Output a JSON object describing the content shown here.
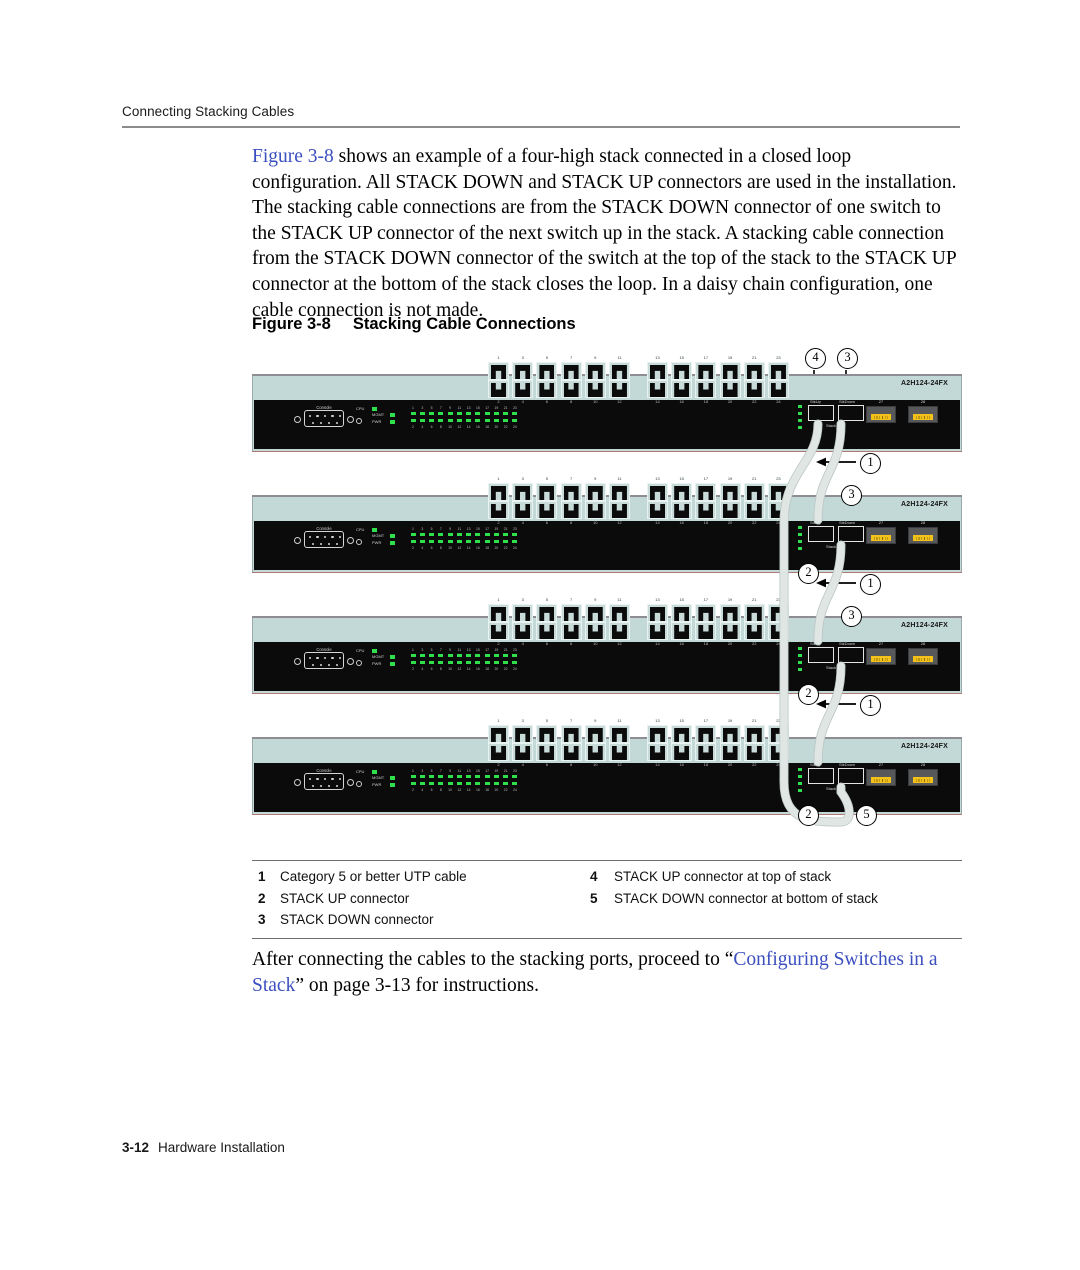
{
  "header": {
    "running_head": "Connecting Stacking Cables"
  },
  "body": {
    "paragraph_lead": "Figure 3-8",
    "paragraph_rest": " shows an example of a four-high stack connected in a closed loop configuration. All STACK DOWN and STACK UP connectors are used in the installation. The stacking cable connections are from the STACK DOWN connector of one switch to the STACK UP connector of the next switch up in the stack. A stacking cable connection from the STACK DOWN connector of the switch at the top of the stack to the STACK UP connector at the bottom of the stack closes the loop. In a daisy chain configuration, one cable connection is not made."
  },
  "figure": {
    "caption_number": "Figure 3-8",
    "caption_title": "Stacking Cable Connections",
    "switch": {
      "model": "A2H124-24FX",
      "console_label": "Console",
      "system_leds": [
        {
          "name": "CPU",
          "label": "CPU"
        },
        {
          "name": "MGMT",
          "label": "MGMT"
        },
        {
          "name": "PWR",
          "label": "PWR"
        }
      ],
      "port_led_numbers_top": [
        "1",
        "3",
        "5",
        "7",
        "9",
        "11",
        "13",
        "15",
        "17",
        "19",
        "21",
        "23"
      ],
      "port_led_numbers_bottom": [
        "2",
        "4",
        "6",
        "8",
        "10",
        "12",
        "14",
        "16",
        "18",
        "20",
        "22",
        "24"
      ],
      "rj45_numbers_top": [
        "1",
        "3",
        "5",
        "7",
        "9",
        "11",
        "13",
        "15",
        "17",
        "19",
        "21",
        "23"
      ],
      "rj45_numbers_bottom": [
        "2",
        "4",
        "6",
        "8",
        "10",
        "12",
        "14",
        "16",
        "18",
        "20",
        "22",
        "24"
      ],
      "stack_up_label": "StkUp",
      "stack_down_label": "StkDown",
      "stack_group_label": "Stack",
      "fiber_ports": [
        "27",
        "28"
      ]
    },
    "callouts": [
      {
        "id": "c4-top",
        "number": "4"
      },
      {
        "id": "c3-top",
        "number": "3"
      },
      {
        "id": "c1-u1",
        "number": "1"
      },
      {
        "id": "c3-u2",
        "number": "3"
      },
      {
        "id": "c2-u2",
        "number": "2"
      },
      {
        "id": "c1-u2",
        "number": "1"
      },
      {
        "id": "c3-u3",
        "number": "3"
      },
      {
        "id": "c2-u3",
        "number": "2"
      },
      {
        "id": "c1-u3",
        "number": "1"
      },
      {
        "id": "c2-u4",
        "number": "2"
      },
      {
        "id": "c5-u4",
        "number": "5"
      }
    ],
    "legend": {
      "left": [
        {
          "key": "1",
          "text": "Category 5 or better UTP cable"
        },
        {
          "key": "2",
          "text": "STACK UP connector"
        },
        {
          "key": "3",
          "text": "STACK DOWN connector"
        }
      ],
      "right": [
        {
          "key": "4",
          "text": "STACK UP connector at top of stack"
        },
        {
          "key": "5",
          "text": "STACK DOWN connector at bottom of stack"
        }
      ]
    }
  },
  "closing": {
    "pre": "After connecting the cables to the stacking ports, proceed to “",
    "link": "Configuring Switches in a Stack",
    "post": "” on page 3-13 for instructions."
  },
  "footer": {
    "page_number": "3-12",
    "book_title": "Hardware Installation"
  },
  "colors": {
    "link": "#3b4fbf",
    "chassis": "#c3d9d7",
    "faceplate": "#0b0b0b",
    "led_green": "#2fe04a",
    "fiber_yellow": "#f2c21a",
    "cable": "#dfe6e4"
  }
}
